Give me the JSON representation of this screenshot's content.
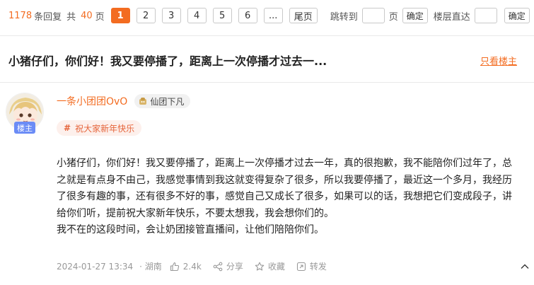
{
  "pagination": {
    "reply_count": "1178",
    "reply_label": "条回复",
    "total_prefix": "共",
    "page_count": "40",
    "page_suffix": "页",
    "pages": [
      "1",
      "2",
      "3",
      "4",
      "5",
      "6"
    ],
    "ellipsis": "...",
    "last_page_label": "尾页",
    "jump_label": "跳转到",
    "jump_unit": "页",
    "confirm_label": "确定",
    "floor_jump_label": "楼层直达",
    "floor_confirm_label": "确定"
  },
  "thread": {
    "title": "小猪仔们，你们好！我又要停播了，距离上一次停播才过去一...",
    "only_host_label": "只看楼主"
  },
  "post": {
    "author": "一条小团团OvO",
    "level_title": "仙团下凡",
    "host_badge": "楼主",
    "topic_tag": "祝大家新年快乐",
    "paragraphs": [
      "小猪仔们，你们好！我又要停播了，距离上一次停播才过去一年，真的很抱歉，我不能陪你们过年了，总之就是有点身不由己，我感觉事情到我这就变得复杂了很多，所以我要停播了，最近这一个多月，我经历了很多有趣的事，还有很多不好的事，感觉自己又成长了很多，如果可以的话，我想把它们变成段子，讲给你们听，提前祝大家新年快乐，不要太想我，我会想你们的。",
      "我不在的这段时间，会让奶团接管直播间，让他们陪陪你们。"
    ],
    "date": "2024-01-27 13:34",
    "location": "· 湖南",
    "like_count": "2.4k",
    "share_label": "分享",
    "favorite_label": "收藏",
    "repost_label": "转发"
  },
  "colors": {
    "accent": "#f36c21",
    "host_badge": "#6b8cf6",
    "tag_bg": "#fdf0ec"
  }
}
